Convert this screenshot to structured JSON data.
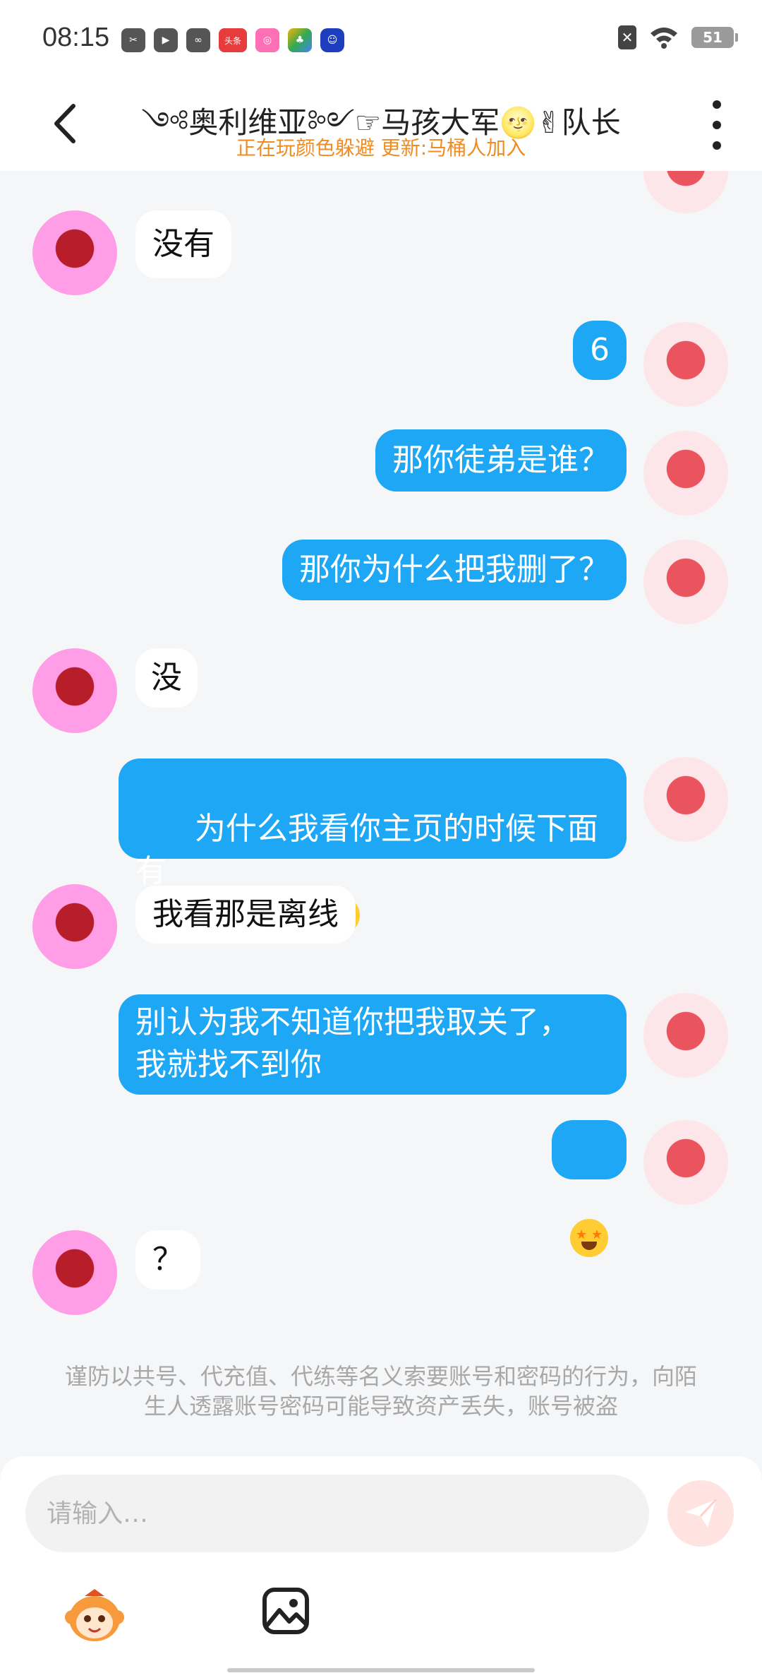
{
  "status_bar": {
    "time": "08:15",
    "app_icons": [
      "scissors-app-icon",
      "play-app-icon",
      "leaf-app-icon",
      "toutiao-app-icon",
      "pink-app-icon",
      "game-center-app-icon",
      "robot-app-icon"
    ],
    "toutiao_label": "头条",
    "battery": "51"
  },
  "header": {
    "title": "༺奥利维亚༻☞马孩大军🌝✌队长",
    "subtitle": "正在玩颜色躲避 更新:马桶人加入"
  },
  "messages": [
    {
      "side": "in",
      "text": "没有"
    },
    {
      "side": "out",
      "text": "6"
    },
    {
      "side": "out",
      "text": "那你徒弟是谁？"
    },
    {
      "side": "out",
      "text": "那你为什么把我删了？"
    },
    {
      "side": "in",
      "text": "没"
    },
    {
      "side": "out",
      "text": "为什么我看你主页的时候下面有\n个加好友呀？",
      "emoji": "heart-eyes-emoji"
    },
    {
      "side": "in",
      "text": "我看那是离线"
    },
    {
      "side": "out",
      "text": "别认为我不知道你把我取关了，\n我就找不到你"
    },
    {
      "side": "out",
      "text": "",
      "emoji": "star-struck-emoji"
    },
    {
      "side": "in",
      "text": "？"
    }
  ],
  "warning": "谨防以共号、代充值、代练等名义索要账号和密码的行为，向陌生人透露账号密码可能导致资产丢失，账号被盗",
  "input": {
    "placeholder": "请输入…",
    "value": ""
  },
  "colors": {
    "accent": "#1ea7f5",
    "subtitle": "#f08c24",
    "send_button_bg": "#ffe3e0",
    "background": "#f5f6f8"
  }
}
